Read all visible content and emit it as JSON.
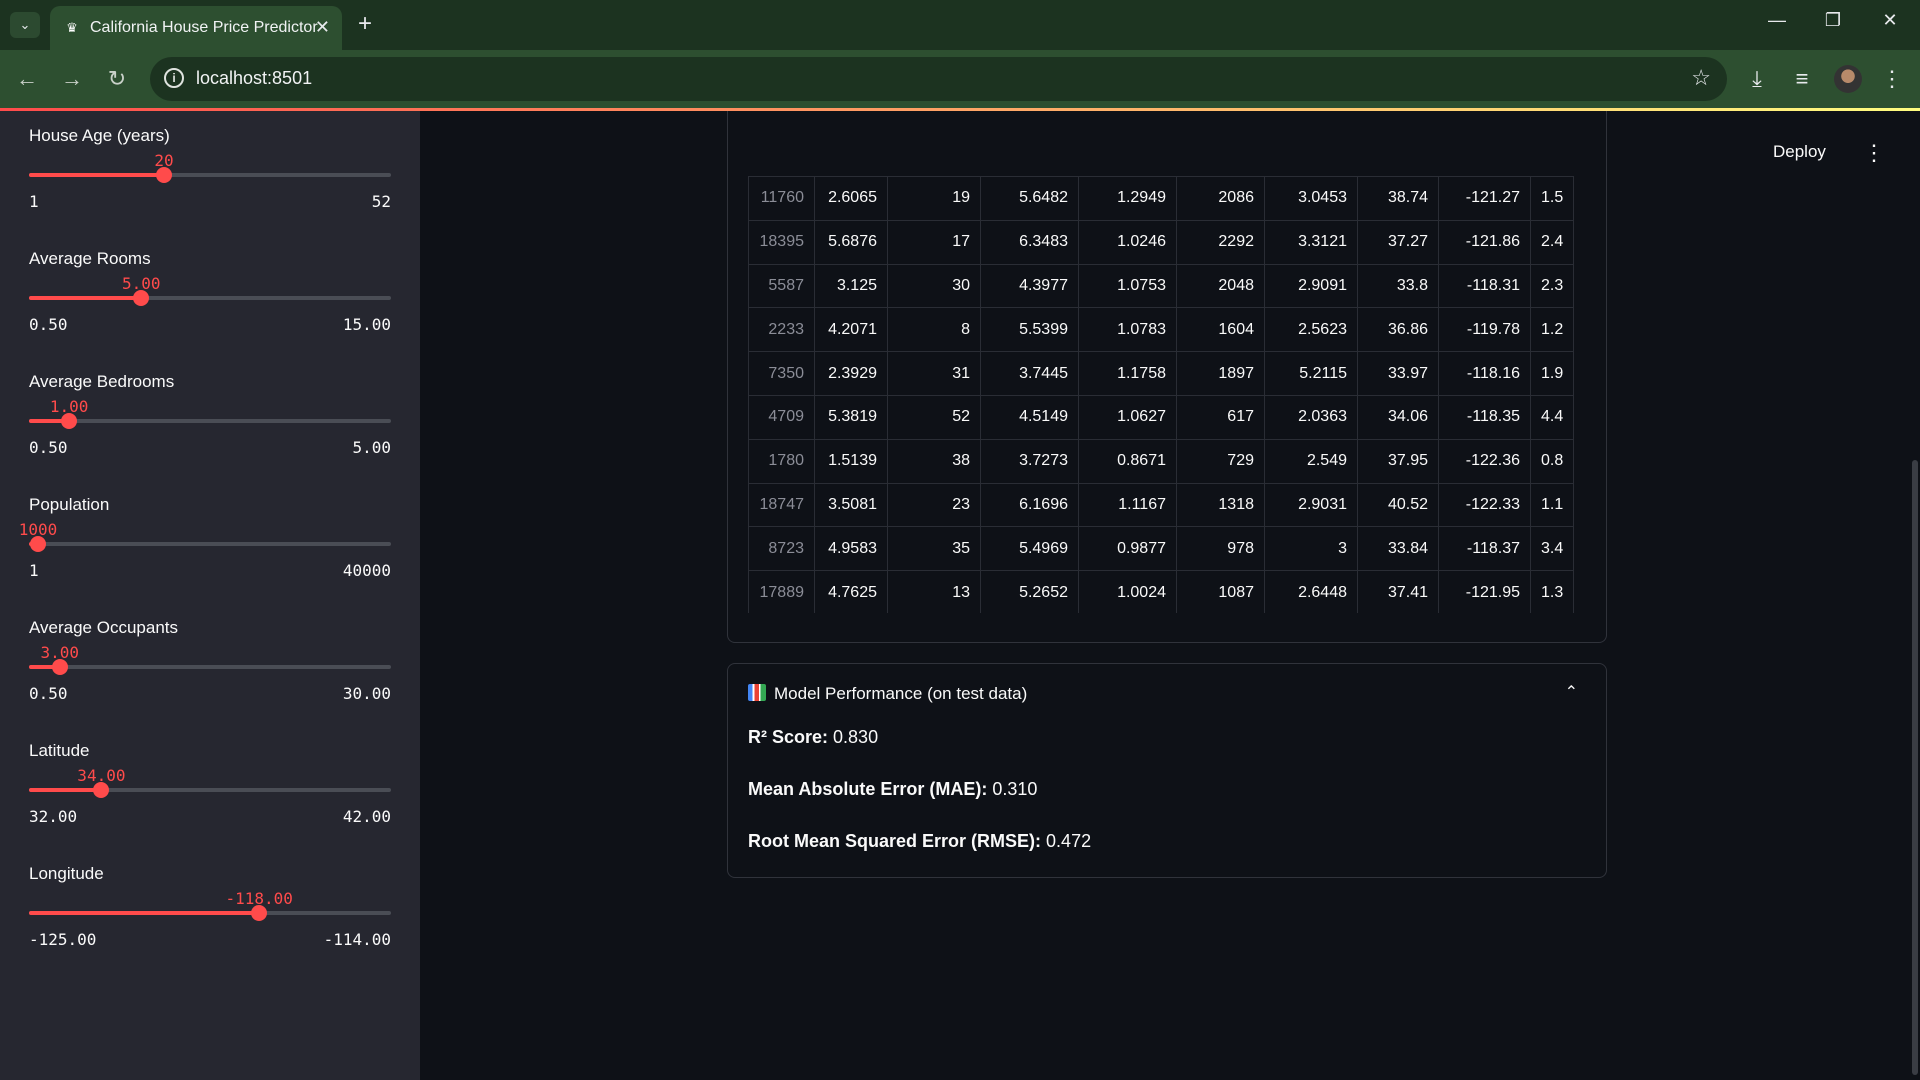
{
  "browser": {
    "tab_title": "California House Price Predictor",
    "url": "localhost:8501"
  },
  "app": {
    "deploy_label": "Deploy"
  },
  "sidebar": {
    "sliders": [
      {
        "label": "House Age (years)",
        "value": "20",
        "min": "1",
        "max": "52",
        "fraction": 0.373
      },
      {
        "label": "Average Rooms",
        "value": "5.00",
        "min": "0.50",
        "max": "15.00",
        "fraction": 0.31
      },
      {
        "label": "Average Bedrooms",
        "value": "1.00",
        "min": "0.50",
        "max": "5.00",
        "fraction": 0.111
      },
      {
        "label": "Population",
        "value": "1000",
        "min": "1",
        "max": "40000",
        "fraction": 0.025
      },
      {
        "label": "Average Occupants",
        "value": "3.00",
        "min": "0.50",
        "max": "30.00",
        "fraction": 0.085
      },
      {
        "label": "Latitude",
        "value": "34.00",
        "min": "32.00",
        "max": "42.00",
        "fraction": 0.2
      },
      {
        "label": "Longitude",
        "value": "-118.00",
        "min": "-125.00",
        "max": "-114.00",
        "fraction": 0.636
      }
    ]
  },
  "dataframe": {
    "rows": [
      [
        "11760",
        "2.6065",
        "19",
        "5.6482",
        "1.2949",
        "2086",
        "3.0453",
        "38.74",
        "-121.27",
        "1.5"
      ],
      [
        "18395",
        "5.6876",
        "17",
        "6.3483",
        "1.0246",
        "2292",
        "3.3121",
        "37.27",
        "-121.86",
        "2.4"
      ],
      [
        "5587",
        "3.125",
        "30",
        "4.3977",
        "1.0753",
        "2048",
        "2.9091",
        "33.8",
        "-118.31",
        "2.3"
      ],
      [
        "2233",
        "4.2071",
        "8",
        "5.5399",
        "1.0783",
        "1604",
        "2.5623",
        "36.86",
        "-119.78",
        "1.2"
      ],
      [
        "7350",
        "2.3929",
        "31",
        "3.7445",
        "1.1758",
        "1897",
        "5.2115",
        "33.97",
        "-118.16",
        "1.9"
      ],
      [
        "4709",
        "5.3819",
        "52",
        "4.5149",
        "1.0627",
        "617",
        "2.0363",
        "34.06",
        "-118.35",
        "4.4"
      ],
      [
        "1780",
        "1.5139",
        "38",
        "3.7273",
        "0.8671",
        "729",
        "2.549",
        "37.95",
        "-122.36",
        "0.8"
      ],
      [
        "18747",
        "3.5081",
        "23",
        "6.1696",
        "1.1167",
        "1318",
        "2.9031",
        "40.52",
        "-122.33",
        "1.1"
      ],
      [
        "8723",
        "4.9583",
        "35",
        "5.4969",
        "0.9877",
        "978",
        "3",
        "33.84",
        "-118.37",
        "3.4"
      ],
      [
        "17889",
        "4.7625",
        "13",
        "5.2652",
        "1.0024",
        "1087",
        "2.6448",
        "37.41",
        "-121.95",
        "1.3"
      ]
    ]
  },
  "performance": {
    "header": "Model Performance (on test data)",
    "r2_label": "R² Score:",
    "r2_value": "0.830",
    "mae_label": "Mean Absolute Error (MAE):",
    "mae_value": "0.310",
    "rmse_label": "Root Mean Squared Error (RMSE):",
    "rmse_value": "0.472"
  },
  "icons": {
    "favicon": "streamlit-crown-icon",
    "chart_emoji": "bar-chart-icon"
  },
  "colors": {
    "accent": "#ff4b4b",
    "sidebar_bg": "#262730",
    "main_bg": "#0e1117"
  }
}
